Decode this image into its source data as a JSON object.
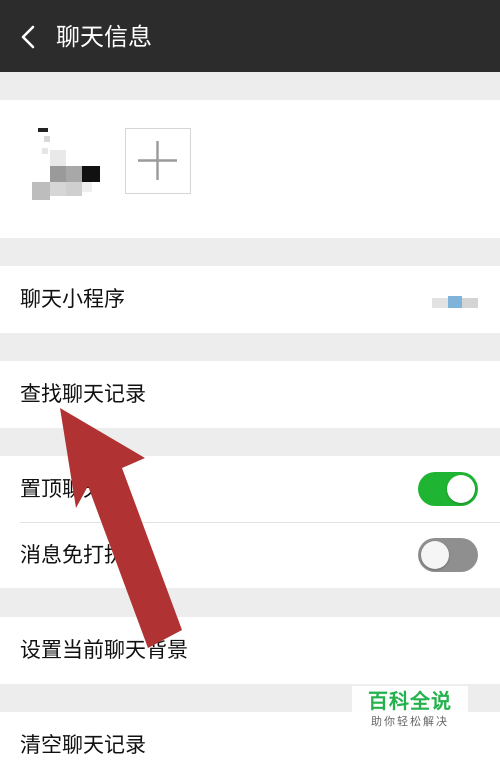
{
  "header": {
    "title": "聊天信息",
    "back_icon": "chevron-left-icon"
  },
  "members": {
    "add_icon": "plus-icon"
  },
  "rows": {
    "mini_programs": "聊天小程序",
    "find_history": "查找聊天记录",
    "pin_chat": "置顶聊天",
    "mute": "消息免打扰",
    "set_background": "设置当前聊天背景",
    "clear_history": "清空聊天记录"
  },
  "toggles": {
    "pin_chat_on": true,
    "mute_on": false
  },
  "watermark": {
    "title": "百科全说",
    "subtitle": "助你轻松解决"
  },
  "colors": {
    "header_bg": "#2c2c2c",
    "toggle_on": "#20b433",
    "toggle_off": "#8f8f8f",
    "arrow": "#b03232",
    "watermark": "#23b24c"
  }
}
